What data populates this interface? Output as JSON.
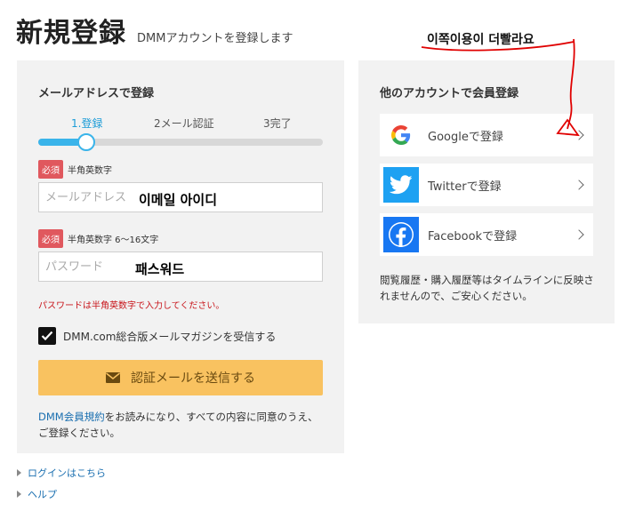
{
  "header": {
    "title": "新規登録",
    "subtitle": "DMMアカウントを登録します"
  },
  "annotation": {
    "text": "이쪽이용이 더빨라요",
    "color": "#e00000"
  },
  "email_form": {
    "section_title": "メールアドレスで登録",
    "steps": [
      {
        "label": "1.登録",
        "active": true
      },
      {
        "label": "2メール認証",
        "active": false
      },
      {
        "label": "3完了",
        "active": false
      }
    ],
    "progress": 0.17,
    "email": {
      "required_badge": "必須",
      "requirement": "半角英数字",
      "placeholder": "メールアドレス",
      "overlay_note": "이메일 아이디"
    },
    "password": {
      "required_badge": "必須",
      "requirement": "半角英数字 6〜16文字",
      "placeholder": "パスワード",
      "overlay_note": "패스워드"
    },
    "error": "パスワードは半角英数字で入力してください。",
    "newsletter": {
      "checked": true,
      "label": "DMM.com総合版メールマガジンを受信する"
    },
    "submit_label": "認証メールを送信する",
    "terms_link": "DMM会員規約",
    "terms_text": "をお読みになり、すべての内容に同意のうえ、ご登録ください。"
  },
  "social": {
    "section_title": "他のアカウントで会員登録",
    "buttons": [
      {
        "name": "google",
        "label": "Googleで登録",
        "icon": "google-icon"
      },
      {
        "name": "twitter",
        "label": "Twitterで登録",
        "icon": "twitter-icon",
        "color": "#1da1f2"
      },
      {
        "name": "facebook",
        "label": "Facebookで登録",
        "icon": "facebook-icon",
        "color": "#1877f2"
      }
    ],
    "note": "閲覧履歴・購入履歴等はタイムラインに反映されませんので、ご安心ください。"
  },
  "footer": {
    "links": [
      "ログインはこちら",
      "ヘルプ"
    ]
  },
  "colors": {
    "accent_blue": "#3ab4ea",
    "submit_yellow": "#f9c260",
    "required_red": "#e0585e",
    "error_red": "#c8151b"
  }
}
